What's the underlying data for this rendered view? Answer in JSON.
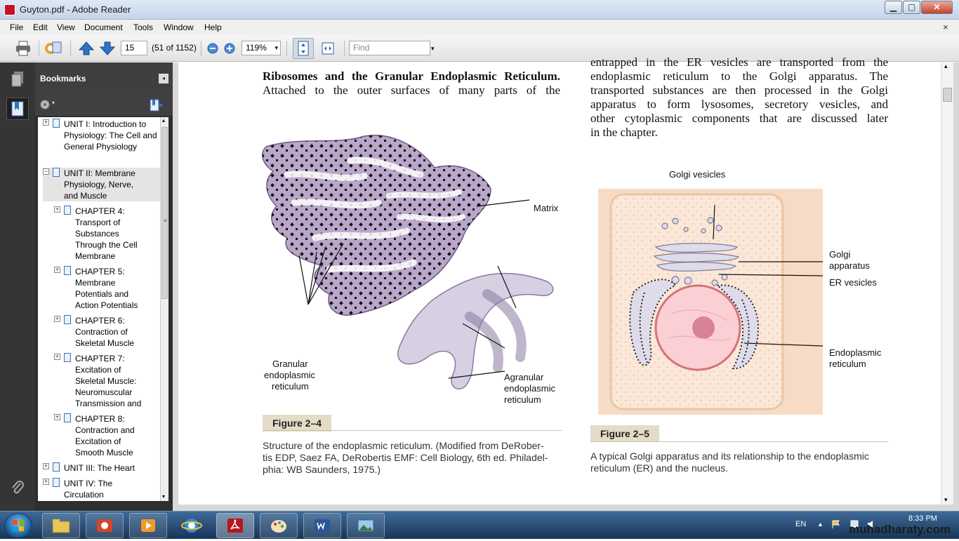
{
  "window": {
    "title": "Guyton.pdf - Adobe Reader",
    "btn_min": "▁",
    "btn_max": "▢",
    "btn_close": "✕",
    "menu_close": "×"
  },
  "menu": [
    "File",
    "Edit",
    "View",
    "Document",
    "Tools",
    "Window",
    "Help"
  ],
  "toolbar": {
    "page_current": "15",
    "page_of": "(51 of 1152)",
    "zoom": "119%",
    "find_placeholder": "Find",
    "dropdown_glyph": "▾"
  },
  "bookmarks": {
    "title": "Bookmarks",
    "options_glyph": "▾",
    "collapse_glyph": "◂",
    "items": [
      {
        "sign": "+",
        "label": "UNIT I: Introduction to Physiology: The Cell and General Physiology"
      },
      {
        "sign": "−",
        "label": "UNIT II: Membrane Physiology, Nerve, and Muscle"
      },
      {
        "sign": "+",
        "label": "CHAPTER 4: Transport of Substances Through the Cell Membrane"
      },
      {
        "sign": "+",
        "label": "CHAPTER 5: Membrane Potentials and Action Potentials"
      },
      {
        "sign": "+",
        "label": "CHAPTER 6: Contraction of Skeletal Muscle"
      },
      {
        "sign": "+",
        "label": "CHAPTER 7: Excitation of Skeletal Muscle: Neuromuscular Transmission and"
      },
      {
        "sign": "+",
        "label": "CHAPTER 8: Contraction and Excitation of Smooth Muscle"
      },
      {
        "sign": "+",
        "label": "UNIT III: The Heart"
      },
      {
        "sign": "+",
        "label": "UNIT IV: The Circulation"
      }
    ],
    "scroll_up": "▴",
    "scroll_down": "▾",
    "grip": "≡"
  },
  "document": {
    "left_bold": "Ribosomes and the Granular Endoplasmic Reticulum.",
    "left_text": "Attached to the outer surfaces of many parts of the",
    "right_top": "entrapped in the ER vesicles are transported from the",
    "right_lines": [
      "endoplasmic reticulum to the Golgi apparatus. The",
      "transported substances are then processed in the Golgi",
      "apparatus to form lysosomes, secretory vesicles, and",
      "other cytoplasmic components that are discussed later",
      "in the chapter."
    ],
    "fig4": {
      "label_matrix": "Matrix",
      "label_granular": [
        "Granular",
        "endoplasmic",
        "reticulum"
      ],
      "label_agranular": [
        "Agranular",
        "endoplasmic",
        "reticulum"
      ],
      "heading": "Figure 2–4",
      "caption": [
        "Structure of the endoplasmic reticulum. (Modified from DeRober-",
        "tis EDP, Saez FA, DeRobertis EMF: Cell Biology, 6th ed. Philadel-",
        "phia: WB Saunders, 1975.)"
      ]
    },
    "fig5": {
      "label_vesicles": "Golgi vesicles",
      "label_apparatus": [
        "Golgi",
        "apparatus"
      ],
      "label_er": "ER vesicles",
      "label_endo": [
        "Endoplasmic",
        "reticulum"
      ],
      "heading": "Figure 2–5",
      "caption": [
        "A typical Golgi apparatus and its relationship to the endoplasmic",
        "reticulum (ER) and the nucleus."
      ]
    }
  },
  "taskbar": {
    "lang": "EN",
    "time": "8:33 PM",
    "watermark": "muhadharaty.com",
    "tray_up": "▲"
  }
}
